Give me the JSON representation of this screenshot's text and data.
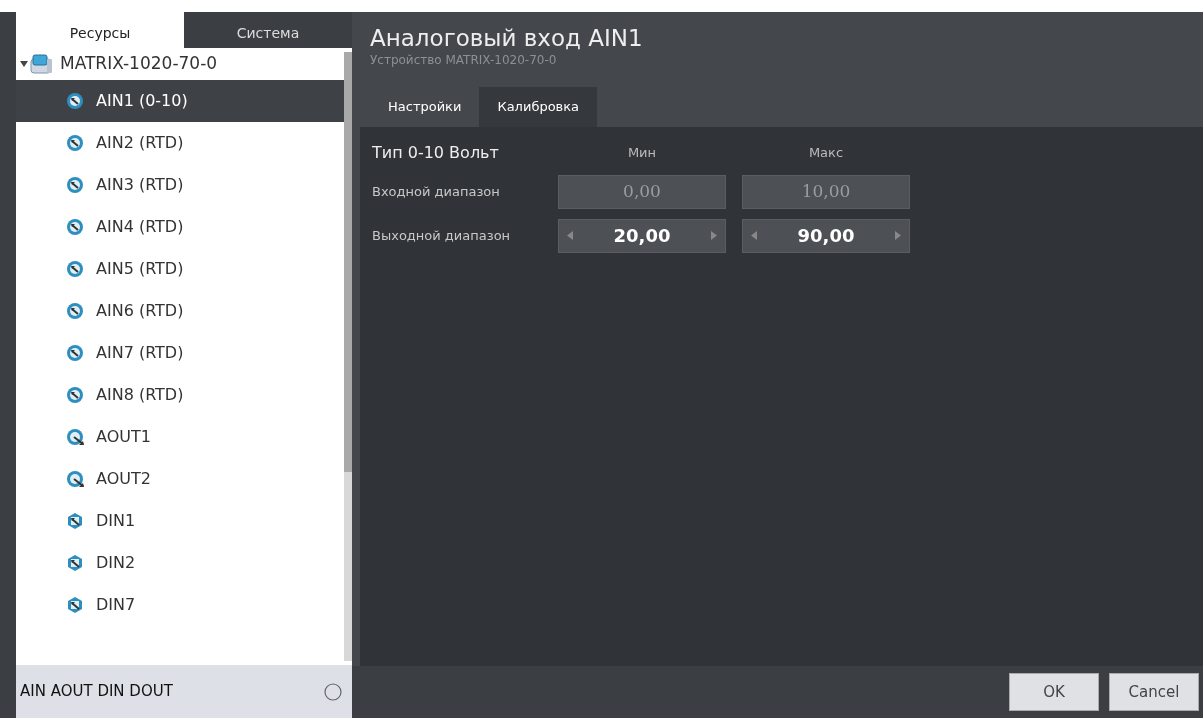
{
  "sidebar": {
    "tabs": [
      {
        "label": "Ресурсы",
        "selected": true
      },
      {
        "label": "Система",
        "selected": false
      }
    ],
    "tree": {
      "label": "MATRIX-1020-70-0",
      "expanded": true,
      "children": [
        {
          "label": "AIN1 (0-10)",
          "kind": "ain",
          "selected": true
        },
        {
          "label": "AIN2 (RTD)",
          "kind": "ain",
          "selected": false
        },
        {
          "label": "AIN3 (RTD)",
          "kind": "ain",
          "selected": false
        },
        {
          "label": "AIN4 (RTD)",
          "kind": "ain",
          "selected": false
        },
        {
          "label": "AIN5 (RTD)",
          "kind": "ain",
          "selected": false
        },
        {
          "label": "AIN6 (RTD)",
          "kind": "ain",
          "selected": false
        },
        {
          "label": "AIN7 (RTD)",
          "kind": "ain",
          "selected": false
        },
        {
          "label": "AIN8 (RTD)",
          "kind": "ain",
          "selected": false
        },
        {
          "label": "AOUT1",
          "kind": "aout",
          "selected": false
        },
        {
          "label": "AOUT2",
          "kind": "aout",
          "selected": false
        },
        {
          "label": "DIN1",
          "kind": "din",
          "selected": false
        },
        {
          "label": "DIN2",
          "kind": "din",
          "selected": false
        },
        {
          "label": "DIN7",
          "kind": "din",
          "selected": false
        }
      ]
    },
    "filter": "AIN AOUT DIN DOUT"
  },
  "header": {
    "title": "Аналоговый вход AIN1",
    "subtitle": "Устройство MATRIX-1020-70-0"
  },
  "tabs": [
    {
      "label": "Настройки",
      "selected": false
    },
    {
      "label": "Калибровка",
      "selected": true
    }
  ],
  "calibration": {
    "type_label": "Тип 0-10 Вольт",
    "columns": [
      "Мин",
      "Макс"
    ],
    "rows": [
      {
        "label": "Входной диапазон",
        "kind": "readonly",
        "values": [
          "0,00",
          "10,00"
        ]
      },
      {
        "label": "Выходной диапазон",
        "kind": "spinner",
        "values": [
          "20,00",
          "90,00"
        ]
      }
    ]
  },
  "buttons": [
    "OK",
    "Cancel"
  ]
}
